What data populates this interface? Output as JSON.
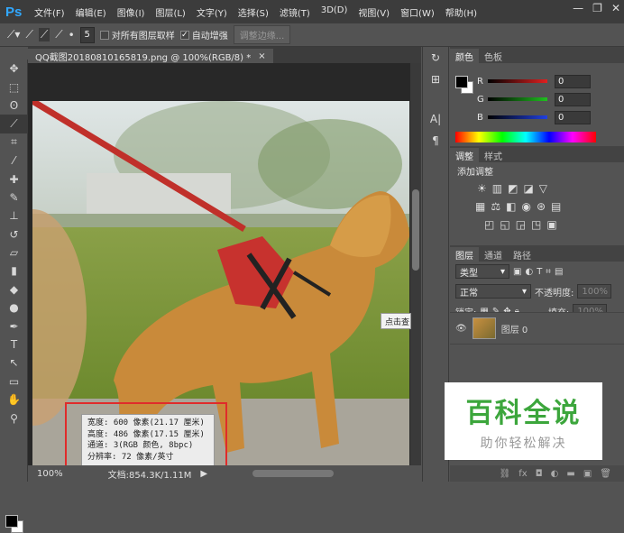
{
  "app": {
    "logo": "Ps"
  },
  "menu": [
    "文件(F)",
    "编辑(E)",
    "图像(I)",
    "图层(L)",
    "文字(Y)",
    "选择(S)",
    "滤镜(T)",
    "3D(D)",
    "视图(V)",
    "窗口(W)",
    "帮助(H)"
  ],
  "window_controls": {
    "minimize": "—",
    "restore": "❐",
    "close": "✕"
  },
  "options": {
    "brush_size": "5",
    "sample_all_layers": {
      "label": "对所有图层取样",
      "checked": false
    },
    "auto_enhance": {
      "label": "自动增强",
      "checked": true
    },
    "refine_edge_label": "调整边缘..."
  },
  "document": {
    "tab_title": "QQ截图20180810165819.png @ 100%(RGB/8) *",
    "close": "×"
  },
  "tooltip": {
    "lines": [
      "宽度: 600 像素(21.17 厘米)",
      "高度: 486 像素(17.15 厘米)",
      "通道: 3(RGB 颜色, 8bpc)",
      "分辨率: 72 像素/英寸"
    ]
  },
  "hint_popup": "点击查",
  "status": {
    "zoom": "100%",
    "doc_info": "文档:854.3K/1.11M"
  },
  "color_panel": {
    "tabs": [
      "颜色",
      "色板"
    ],
    "channels": [
      {
        "label": "R",
        "value": "0",
        "color": "#e02020"
      },
      {
        "label": "G",
        "value": "0",
        "color": "#20c020"
      },
      {
        "label": "B",
        "value": "0",
        "color": "#2040e0"
      }
    ]
  },
  "adjust_panel": {
    "tabs": [
      "调整",
      "样式"
    ],
    "title": "添加调整"
  },
  "layers_panel": {
    "tabs": [
      "图层",
      "通道",
      "路径"
    ],
    "filter_kind": "类型",
    "blend_mode": "正常",
    "opacity_label": "不透明度:",
    "opacity_value": "100%",
    "lock_label": "锁定:",
    "fill_label": "填充:",
    "fill_value": "100%",
    "layer_name": "图层 0"
  },
  "watermark": {
    "title": "百科全说",
    "subtitle": "助你轻松解决"
  }
}
